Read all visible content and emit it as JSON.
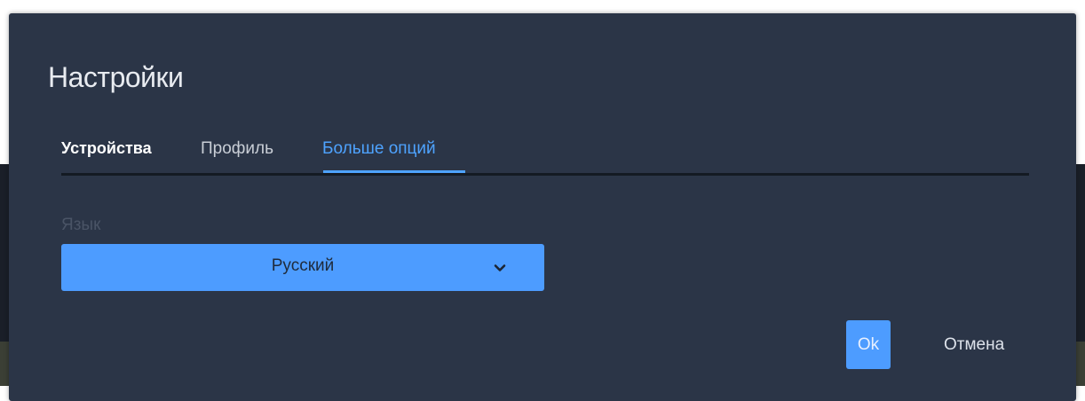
{
  "dialog": {
    "title": "Настройки",
    "tabs": [
      {
        "label": "Устройства",
        "state": "default"
      },
      {
        "label": "Профиль",
        "state": "default"
      },
      {
        "label": "Больше опций",
        "state": "active"
      }
    ],
    "language": {
      "label": "Язык",
      "selected": "Русский"
    },
    "buttons": {
      "ok": "Ok",
      "cancel": "Отмена"
    }
  },
  "icons": {
    "select_chevron": "chevron-down-icon"
  },
  "colors": {
    "dialog_background": "#2b3547",
    "accent": "#4d9cff",
    "active_tab": "#4ea3ff",
    "muted_label": "#4a5466"
  }
}
